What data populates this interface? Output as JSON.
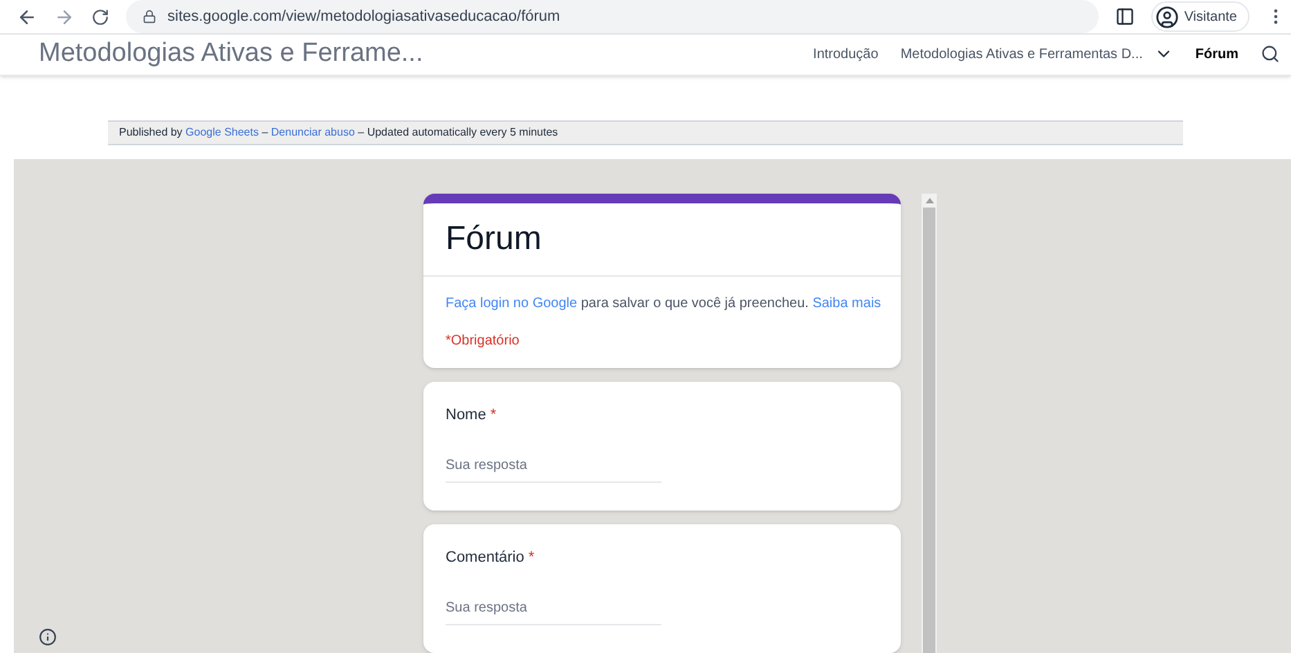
{
  "browser": {
    "url": "sites.google.com/view/metodologiasativaseducacao/fórum",
    "profile": "Visitante"
  },
  "site": {
    "title": "Metodologias Ativas e Ferrame...",
    "nav": [
      {
        "label": "Introdução",
        "selected": false,
        "has_menu": false
      },
      {
        "label": "Metodologias Ativas e Ferramentas D...",
        "selected": false,
        "has_menu": true
      },
      {
        "label": "Fórum",
        "selected": true,
        "has_menu": false
      }
    ]
  },
  "published_bar": {
    "prefix": "Published by",
    "source_link": "Google Sheets",
    "separator_1": "–",
    "abuse_link": "Denunciar abuso",
    "separator_2": "–",
    "note": "Updated automatically every 5 minutes"
  },
  "form": {
    "title": "Fórum",
    "login_link": "Faça login no Google",
    "login_text": "para salvar o que você já preencheu.",
    "learn_link": "Saiba mais",
    "required_note": "*Obrigatório",
    "questions": [
      {
        "label": "Nome",
        "required_mark": "*",
        "placeholder": "Sua resposta"
      },
      {
        "label": "Comentário",
        "required_mark": "*",
        "placeholder": "Sua resposta"
      }
    ]
  }
}
